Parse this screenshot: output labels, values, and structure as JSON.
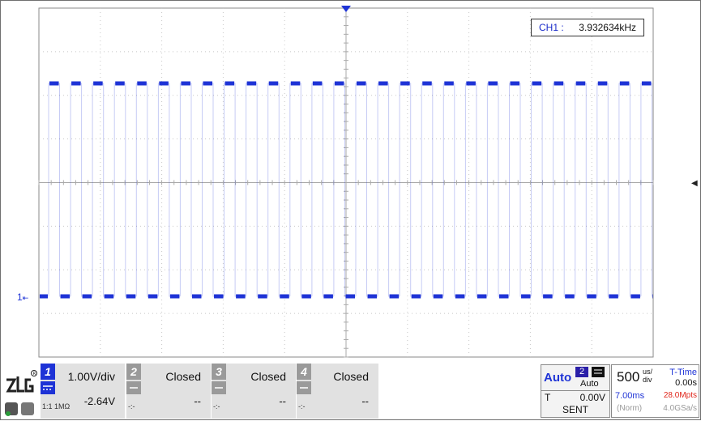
{
  "measurement": {
    "label": "CH1 :",
    "value": "3.932634kHz"
  },
  "trace": {
    "channel_marker": "1",
    "color": "#1e33d6",
    "cycles": 28
  },
  "channels": [
    {
      "num": "1",
      "top": "1.00V/div",
      "bottom": "-2.64V",
      "bottom_left": "1:1 1MΩ",
      "active": true
    },
    {
      "num": "2",
      "top": "Closed",
      "bottom": "--",
      "bottom_left": "-:-",
      "active": false
    },
    {
      "num": "3",
      "top": "Closed",
      "bottom": "--",
      "bottom_left": "-:-",
      "active": false
    },
    {
      "num": "4",
      "top": "Closed",
      "bottom": "--",
      "bottom_left": "-:-",
      "active": false
    }
  ],
  "trigger": {
    "mode": "Auto",
    "source_num": "2",
    "sub": "Auto",
    "type": "T",
    "level": "0.00V",
    "status": "SENT"
  },
  "timebase": {
    "value": "500",
    "unit_top": "us/",
    "unit_bottom": "div",
    "delay": "7.00ms",
    "mode": "(Norm)"
  },
  "time": {
    "label": "T-Time",
    "value": "0.00s",
    "mem": "28.0Mpts",
    "rate": "4.0GSa/s"
  },
  "logo": {
    "text": "ZLG"
  },
  "colors": {
    "accent": "#1e33d6",
    "grid": "#c8c8c8",
    "red": "#e0261b"
  }
}
